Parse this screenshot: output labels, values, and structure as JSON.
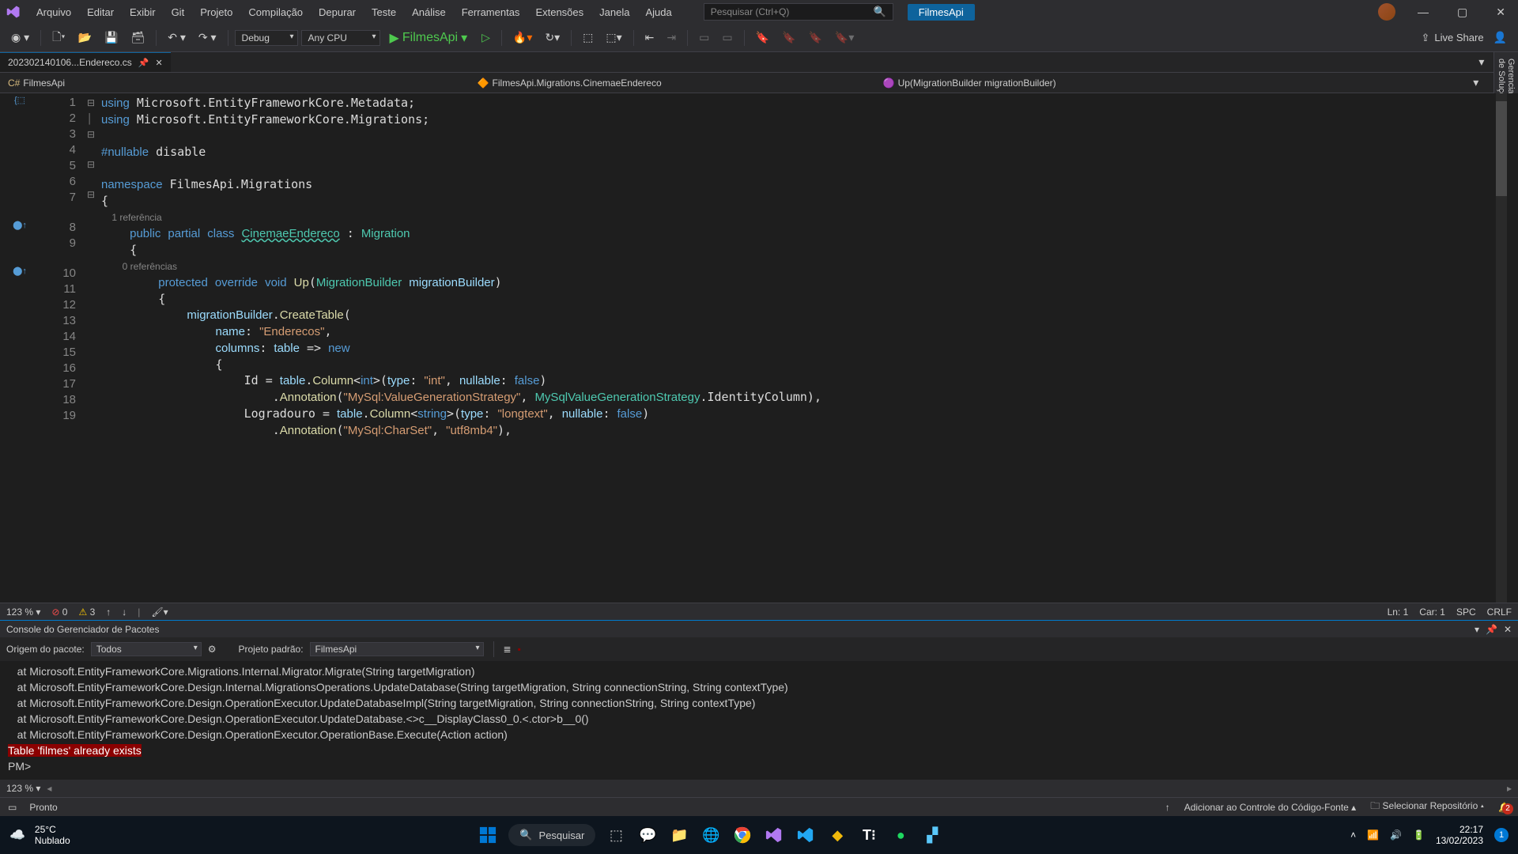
{
  "menu": [
    "Arquivo",
    "Editar",
    "Exibir",
    "Git",
    "Projeto",
    "Compilação",
    "Depurar",
    "Teste",
    "Análise",
    "Ferramentas",
    "Extensões",
    "Janela",
    "Ajuda"
  ],
  "search_placeholder": "Pesquisar (Ctrl+Q)",
  "solution_name": "FilmesApi",
  "toolbar": {
    "config": "Debug",
    "platform": "Any CPU",
    "start_label": "FilmesApi"
  },
  "live_share": "Live Share",
  "tab": {
    "name": "202302140106...Endereco.cs"
  },
  "breadcrumb": {
    "project": "FilmesApi",
    "class": "FilmesApi.Migrations.CinemaeEndereco",
    "method": "Up(MigrationBuilder migrationBuilder)"
  },
  "code_refs": {
    "class_ref": "1 referência",
    "method_ref": "0 referências"
  },
  "lines": [
    "1",
    "2",
    "3",
    "4",
    "5",
    "6",
    "7",
    "8",
    "9",
    "10",
    "11",
    "12",
    "13",
    "14",
    "15",
    "16",
    "17",
    "18",
    "19"
  ],
  "editor_status": {
    "zoom": "123 %",
    "errors": "0",
    "warnings": "3",
    "ln": "Ln: 1",
    "car": "Car: 1",
    "spc": "SPC",
    "crlf": "CRLF"
  },
  "panel": {
    "title": "Console do Gerenciador de Pacotes",
    "origin_label": "Origem do pacote:",
    "origin_value": "Todos",
    "project_label": "Projeto padrão:",
    "project_value": "FilmesApi",
    "zoom": "123 %"
  },
  "console_lines": [
    "   at Microsoft.EntityFrameworkCore.Migrations.Internal.Migrator.Migrate(String targetMigration)",
    "   at Microsoft.EntityFrameworkCore.Design.Internal.MigrationsOperations.UpdateDatabase(String targetMigration, String connectionString, String contextType)",
    "   at Microsoft.EntityFrameworkCore.Design.OperationExecutor.UpdateDatabaseImpl(String targetMigration, String connectionString, String contextType)",
    "   at Microsoft.EntityFrameworkCore.Design.OperationExecutor.UpdateDatabase.<>c__DisplayClass0_0.<.ctor>b__0()",
    "   at Microsoft.EntityFrameworkCore.Design.OperationExecutor.OperationBase.Execute(Action action)"
  ],
  "console_error": "Table 'filmes' already exists",
  "console_prompt": "PM>",
  "ide_status": {
    "ready": "Pronto",
    "add_source": "Adicionar ao Controle do Código-Fonte",
    "select_repo": "Selecionar Repositório",
    "notif_count": "2"
  },
  "taskbar": {
    "temp": "25°C",
    "weather": "Nublado",
    "search": "Pesquisar",
    "time": "22:17",
    "date": "13/02/2023",
    "badge": "1"
  },
  "side_panel": "Gerenciador de Soluções"
}
